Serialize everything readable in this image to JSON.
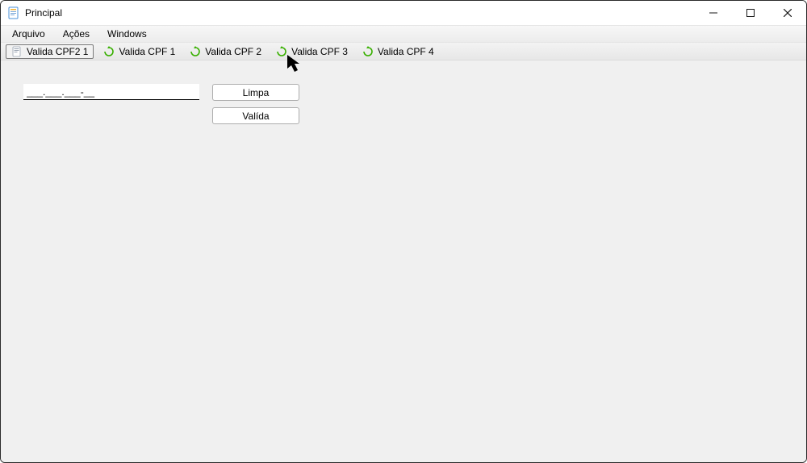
{
  "window": {
    "title": "Principal"
  },
  "menu": {
    "arquivo": "Arquivo",
    "acoes": "Ações",
    "windows": "Windows"
  },
  "tabs": {
    "t0": "Valida CPF2 1",
    "t1": "Valida CPF 1",
    "t2": "Valida CPF 2",
    "t3": "Valida CPF 3",
    "t4": "Valida CPF 4"
  },
  "form": {
    "cpf_mask": "___.___.___-__",
    "limpa": "Limpa",
    "valida": "Valída"
  }
}
